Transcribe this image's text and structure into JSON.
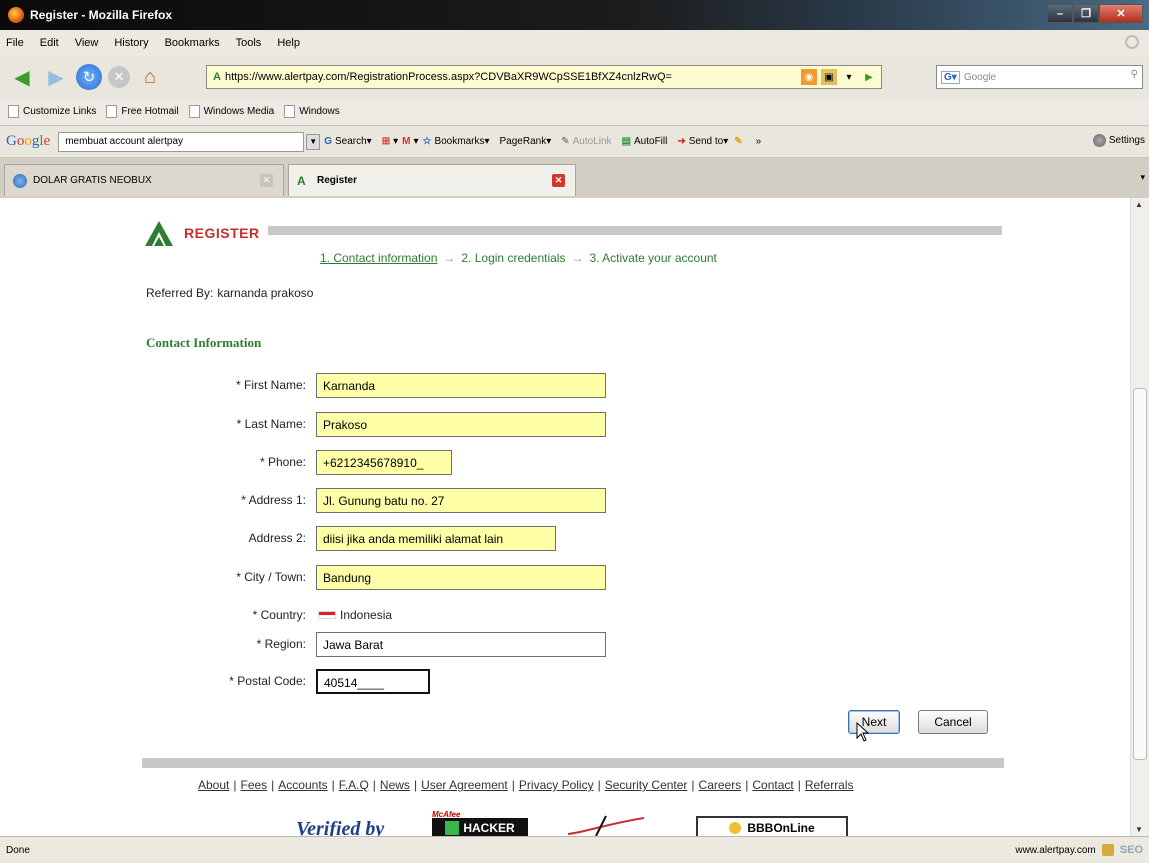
{
  "window": {
    "title": "Register - Mozilla Firefox"
  },
  "menu": [
    "File",
    "Edit",
    "View",
    "History",
    "Bookmarks",
    "Tools",
    "Help"
  ],
  "nav": {
    "url": "https://www.alertpay.com/RegistrationProcess.aspx?CDVBaXR9WCpSSE1BfXZ4cnlzRwQ=",
    "search_placeholder": "Google"
  },
  "bookmarks": [
    "Customize Links",
    "Free Hotmail",
    "Windows Media",
    "Windows"
  ],
  "google_toolbar": {
    "query": "membuat account alertpay",
    "items": [
      "Search",
      "Bookmarks",
      "PageRank",
      "AutoLink",
      "AutoFill",
      "Send to"
    ],
    "more": "»",
    "settings": "Settings"
  },
  "tabs": [
    {
      "label": "DOLAR GRATIS NEOBUX",
      "active": false
    },
    {
      "label": "Register",
      "active": true
    }
  ],
  "page": {
    "heading": "REGISTER",
    "steps": [
      "1. Contact information",
      "2. Login credentials",
      "3. Activate your account"
    ],
    "step_arrow": "→",
    "referred_label": "Referred By:",
    "referred_value": "karnanda prakoso",
    "section_title": "Contact Information",
    "fields": {
      "first_name": {
        "label": "* First Name:",
        "value": "Karnanda"
      },
      "last_name": {
        "label": "* Last Name:",
        "value": "Prakoso"
      },
      "phone": {
        "label": "* Phone:",
        "value": "+6212345678910_"
      },
      "address1": {
        "label": "* Address 1:",
        "value": "Jl. Gunung batu no. 27"
      },
      "address2": {
        "label": "Address 2:",
        "value": "diisi jika anda memiliki alamat lain"
      },
      "city": {
        "label": "* City / Town:",
        "value": "Bandung"
      },
      "country": {
        "label": "* Country:",
        "value": "Indonesia"
      },
      "region": {
        "label": "* Region:",
        "value": "Jawa Barat"
      },
      "postal": {
        "label": "* Postal Code:",
        "value": "40514____"
      }
    },
    "buttons": {
      "next": "Next",
      "cancel": "Cancel"
    },
    "footer_links": [
      "About",
      "Fees",
      "Accounts",
      "F.A.Q",
      "News",
      "User Agreement",
      "Privacy Policy",
      "Security Center",
      "Careers",
      "Contact",
      "Referrals"
    ],
    "badges": {
      "verified": "Verified by",
      "mcafee": "McAfee",
      "hacker": "HACKER",
      "bbb": "BBBOnLine"
    }
  },
  "status": {
    "left": "Done",
    "host": "www.alertpay.com",
    "seo": "SEO"
  }
}
